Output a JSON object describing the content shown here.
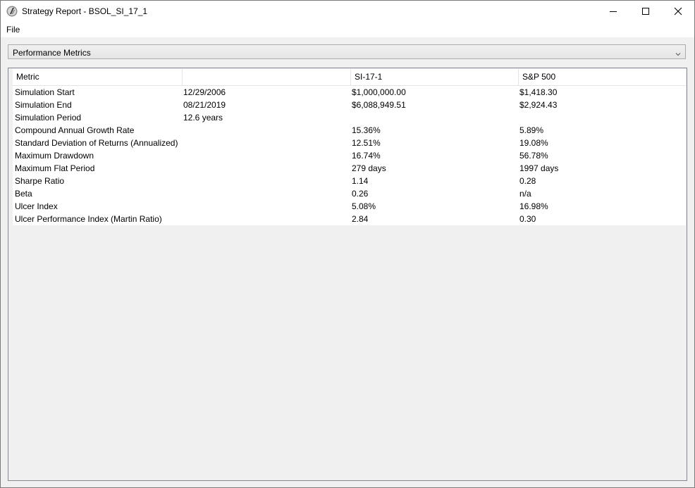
{
  "window": {
    "title": "Strategy Report - BSOL_SI_17_1"
  },
  "menu": {
    "file": "File"
  },
  "selector": {
    "value": "Performance Metrics"
  },
  "table": {
    "headers": [
      "Metric",
      "",
      "SI-17-1",
      "S&P 500"
    ],
    "rows": [
      [
        "Simulation Start",
        "12/29/2006",
        "$1,000,000.00",
        "$1,418.30"
      ],
      [
        "Simulation End",
        "08/21/2019",
        "$6,088,949.51",
        "$2,924.43"
      ],
      [
        "Simulation Period",
        "12.6 years",
        "",
        ""
      ],
      [
        "Compound Annual Growth Rate",
        "",
        "15.36%",
        "5.89%"
      ],
      [
        "Standard Deviation of Returns (Annualized)",
        "",
        "12.51%",
        "19.08%"
      ],
      [
        "Maximum Drawdown",
        "",
        "16.74%",
        "56.78%"
      ],
      [
        "Maximum Flat Period",
        "",
        "279 days",
        "1997 days"
      ],
      [
        "Sharpe Ratio",
        "",
        "1.14",
        "0.28"
      ],
      [
        "Beta",
        "",
        "0.26",
        "n/a"
      ],
      [
        "Ulcer Index",
        "",
        "5.08%",
        "16.98%"
      ],
      [
        "Ulcer Performance Index (Martin Ratio)",
        "",
        "2.84",
        "0.30"
      ]
    ]
  }
}
